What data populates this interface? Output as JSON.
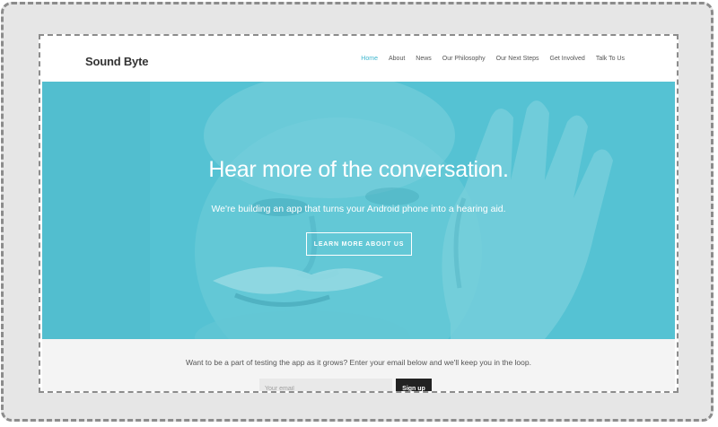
{
  "header": {
    "brand": "Sound Byte",
    "nav": [
      "Home",
      "About",
      "News",
      "Our Philosophy",
      "Our Next Steps",
      "Get Involved",
      "Talk To Us"
    ],
    "active_nav": "Home",
    "accent_color": "#3fb7cf"
  },
  "hero": {
    "title": "Hear more of the conversation.",
    "subtitle": "We're building an app that turns your Android phone into a hearing aid.",
    "cta_label": "LEARN MORE ABOUT US",
    "overlay_color": "#55c2d3",
    "image_description_icon": "man-cupping-ear-photo"
  },
  "signup": {
    "text": "Want to be a part of testing the app as it grows? Enter your email below and we'll keep you in the loop.",
    "email_placeholder": "Your email",
    "button_label": "Sign up"
  }
}
